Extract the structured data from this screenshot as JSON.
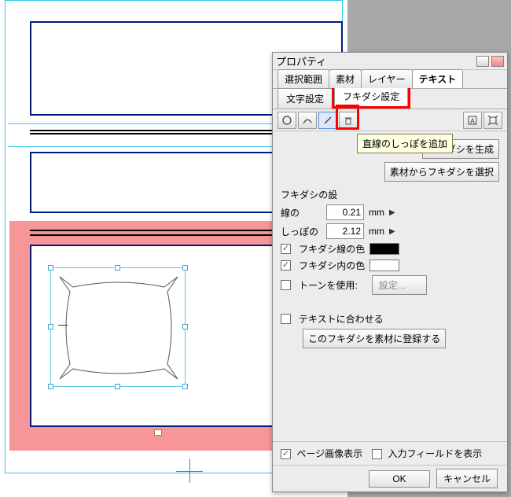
{
  "panel": {
    "title": "プロパティ",
    "tabs": {
      "selection": "選択範囲",
      "material": "素材",
      "layer": "レイヤー",
      "text": "テキスト"
    },
    "subtabs": {
      "char": "文字設定",
      "fukidashi": "フキダシ設定"
    },
    "toolbar_tooltip": "直線のしっぽを追加",
    "buttons": {
      "generate": "フキダシを生成",
      "from_material": "素材からフキダシを選択",
      "register": "このフキダシを素材に登録する",
      "tone_settings": "設定...",
      "ok": "OK",
      "cancel": "キャンセル"
    },
    "section_header": "フキダシの設",
    "fields": {
      "line_label": "線の",
      "line_value": "0.21",
      "tail_label": "しっぽの",
      "tail_value": "2.12",
      "unit": "mm"
    },
    "checks": {
      "line_color": "フキダシ線の色",
      "fill_color": "フキダシ内の色",
      "use_tone": "トーンを使用:",
      "fit_text": "テキストに合わせる",
      "show_page": "ページ画像表示",
      "show_fields": "入力フィールドを表示"
    }
  }
}
